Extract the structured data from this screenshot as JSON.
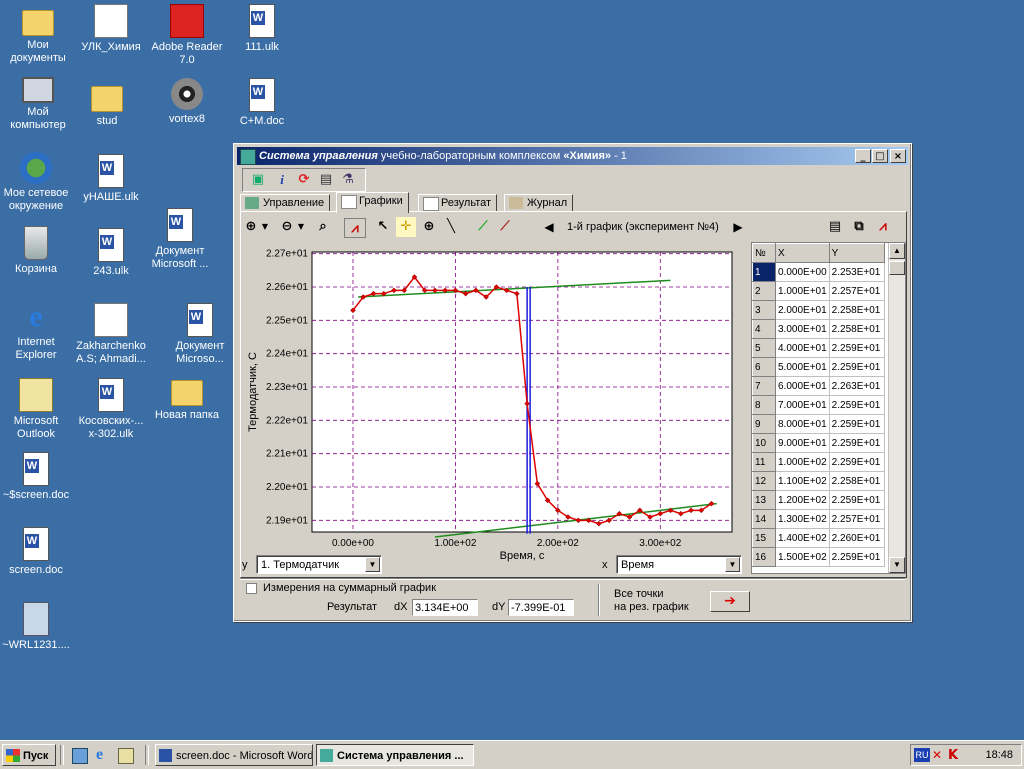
{
  "desktop": {
    "icons": [
      {
        "label": "Мои документы",
        "icon": "folder-icon"
      },
      {
        "label": "УЛК_Химия",
        "icon": "app-icon"
      },
      {
        "label": "Adobe Reader 7.0",
        "icon": "pdf-icon"
      },
      {
        "label": "111.ulk",
        "icon": "word-doc-icon"
      },
      {
        "label": "Мой компьютер",
        "icon": "computer-icon"
      },
      {
        "label": "stud",
        "icon": "folder-icon"
      },
      {
        "label": "vortex8",
        "icon": "vortex-icon"
      },
      {
        "label": "C+M.doc",
        "icon": "word-doc-icon"
      },
      {
        "label": "Мое сетевое окружение",
        "icon": "network-icon"
      },
      {
        "label": "уНАШЕ.ulk",
        "icon": "word-doc-icon"
      },
      {
        "label": "Документ Microsoft ...",
        "icon": "word-doc-icon"
      },
      {
        "label": "Корзина",
        "icon": "recycle-bin-icon"
      },
      {
        "label": "243.ulk",
        "icon": "word-doc-icon"
      },
      {
        "label": "Internet Explorer",
        "icon": "ie-icon"
      },
      {
        "label": "Zakharchenko A.S; Ahmadi...",
        "icon": "app-icon"
      },
      {
        "label": "Документ Microso...",
        "icon": "word-doc-icon"
      },
      {
        "label": "Microsoft Outlook",
        "icon": "outlook-icon"
      },
      {
        "label": "Косовских-... x-302.ulk",
        "icon": "word-doc-icon"
      },
      {
        "label": "Новая папка",
        "icon": "folder-icon"
      },
      {
        "label": "~$screen.doc",
        "icon": "word-doc-icon"
      },
      {
        "label": "screen.doc",
        "icon": "word-doc-icon"
      },
      {
        "label": "~WRL1231....",
        "icon": "file-icon"
      }
    ]
  },
  "window": {
    "title_italic": "Система управления",
    "title_mid": " учебно-лабораторным комплексом ",
    "title_bold": "«Химия»",
    "title_suffix": " - 1",
    "tabs": [
      {
        "label": "Управление",
        "icon": "control-icon"
      },
      {
        "label": "Графики",
        "icon": "graph-icon"
      },
      {
        "label": "Результат",
        "icon": "result-icon"
      },
      {
        "label": "Журнал",
        "icon": "journal-icon"
      }
    ],
    "nav_label": "1-й график (эксперимент №4)",
    "table": {
      "headers": [
        "№",
        "X",
        "Y"
      ],
      "rows": [
        [
          "1",
          "0.000E+00",
          "2.253E+01"
        ],
        [
          "2",
          "1.000E+01",
          "2.257E+01"
        ],
        [
          "3",
          "2.000E+01",
          "2.258E+01"
        ],
        [
          "4",
          "3.000E+01",
          "2.258E+01"
        ],
        [
          "5",
          "4.000E+01",
          "2.259E+01"
        ],
        [
          "6",
          "5.000E+01",
          "2.259E+01"
        ],
        [
          "7",
          "6.000E+01",
          "2.263E+01"
        ],
        [
          "8",
          "7.000E+01",
          "2.259E+01"
        ],
        [
          "9",
          "8.000E+01",
          "2.259E+01"
        ],
        [
          "10",
          "9.000E+01",
          "2.259E+01"
        ],
        [
          "11",
          "1.000E+02",
          "2.259E+01"
        ],
        [
          "12",
          "1.100E+02",
          "2.258E+01"
        ],
        [
          "13",
          "1.200E+02",
          "2.259E+01"
        ],
        [
          "14",
          "1.300E+02",
          "2.257E+01"
        ],
        [
          "15",
          "1.400E+02",
          "2.260E+01"
        ],
        [
          "16",
          "1.500E+02",
          "2.259E+01"
        ]
      ],
      "selected_row": 1
    },
    "y_label": "y",
    "y_select": "1. Термодатчик",
    "x_label": "x",
    "x_select": "Время",
    "checkbox_label": "Измерения на суммарный график",
    "result_label": "Результат",
    "dx_label": "dX",
    "dx_value": "3.134E+00",
    "dy_label": "dY",
    "dy_value": "-7.399E-01",
    "all_points_line1": "Все точки",
    "all_points_line2": "на рез. график"
  },
  "chart_data": {
    "type": "line",
    "xlabel": "Время, с",
    "ylabel": "Термодатчик, С",
    "xlim": [
      -40,
      370
    ],
    "ylim": [
      21.865,
      22.705
    ],
    "xticks": [
      0,
      100,
      200,
      300
    ],
    "xtick_labels": [
      "0.00e+00",
      "1.00e+02",
      "2.00e+02",
      "3.00e+02"
    ],
    "yticks": [
      21.9,
      22.0,
      22.1,
      22.2,
      22.3,
      22.4,
      22.5,
      22.6,
      22.7
    ],
    "ytick_labels": [
      "2.19e+01",
      "2.20e+01",
      "2.21e+01",
      "2.22e+01",
      "2.23e+01",
      "2.24e+01",
      "2.25e+01",
      "2.26e+01",
      "2.27e+01"
    ],
    "grid": true,
    "series": [
      {
        "color": "#e00000",
        "x": [
          0,
          10,
          20,
          30,
          40,
          50,
          60,
          70,
          80,
          90,
          100,
          110,
          120,
          130,
          140,
          150,
          160,
          170,
          180,
          190,
          200,
          210,
          220,
          230,
          240,
          250,
          260,
          270,
          280,
          290,
          300,
          310,
          320,
          330,
          340,
          350
        ],
        "y": [
          22.53,
          22.57,
          22.58,
          22.58,
          22.59,
          22.59,
          22.63,
          22.59,
          22.59,
          22.59,
          22.59,
          22.58,
          22.59,
          22.57,
          22.6,
          22.59,
          22.58,
          22.25,
          22.01,
          21.96,
          21.93,
          21.91,
          21.9,
          21.9,
          21.89,
          21.9,
          21.92,
          21.91,
          21.93,
          21.91,
          21.92,
          21.93,
          21.92,
          21.93,
          21.93,
          21.95
        ]
      }
    ],
    "fit_lines": [
      {
        "color": "#1e8c1e",
        "x": [
          5,
          310
        ],
        "y": [
          22.57,
          22.62
        ]
      },
      {
        "color": "#1e8c1e",
        "x": [
          80,
          355
        ],
        "y": [
          21.85,
          21.95
        ]
      }
    ],
    "cursor": {
      "color": "#1a1ae0",
      "x": 170,
      "y": [
        21.86,
        22.6
      ]
    }
  },
  "taskbar": {
    "start_label": "Пуск",
    "tasks": [
      {
        "label": "screen.doc - Microsoft Word",
        "active": false
      },
      {
        "label": "Система управления ...",
        "active": true
      }
    ],
    "lang": "RU",
    "clock": "18:48"
  }
}
